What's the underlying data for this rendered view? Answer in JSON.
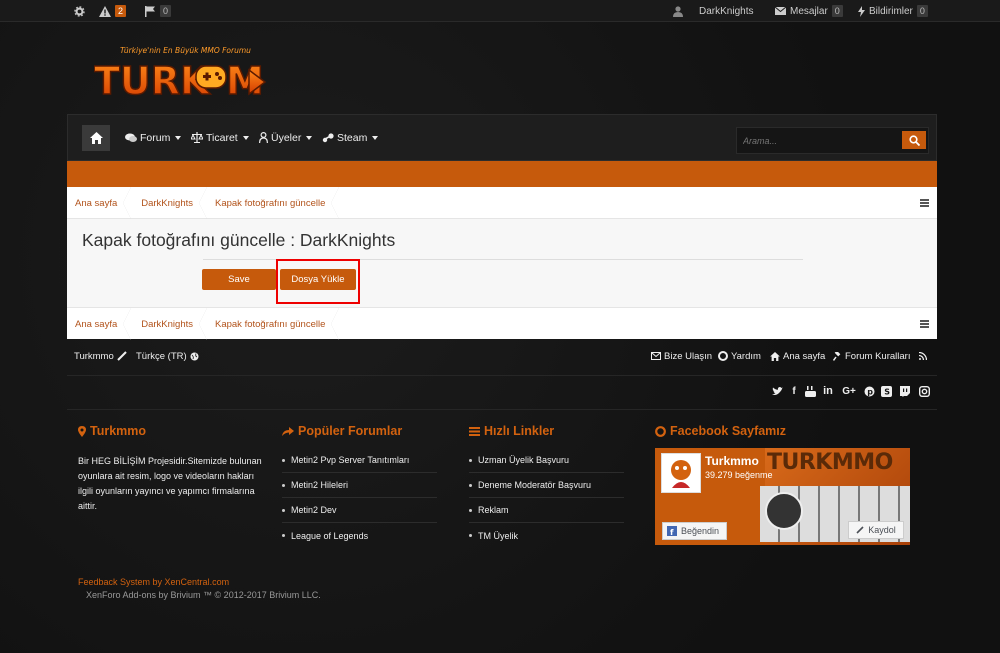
{
  "topbar": {
    "alerts_count": "2",
    "flags_count": "0",
    "username": "DarkKnights",
    "messages_label": "Mesajlar",
    "messages_count": "0",
    "notifications_label": "Bildirimler",
    "notifications_count": "0"
  },
  "logo": {
    "tagline": "Türkiye'nin En Büyük MMO Forumu",
    "name_part1": "TURK",
    "name_part2": "M",
    "name_part3": "O"
  },
  "nav": {
    "items": [
      {
        "label": "Forum"
      },
      {
        "label": "Ticaret"
      },
      {
        "label": "Üyeler"
      },
      {
        "label": "Steam"
      }
    ],
    "search_placeholder": "Arama..."
  },
  "breadcrumb": [
    "Ana sayfa",
    "DarkKnights",
    "Kapak fotoğrafını güncelle"
  ],
  "main": {
    "title": "Kapak fotoğrafını güncelle : DarkKnights",
    "save_label": "Save",
    "upload_label": "Dosya Yükle"
  },
  "footer": {
    "site_name": "Turkmmo",
    "language": "Türkçe (TR)",
    "links": [
      "Bize Ulaşın",
      "Yardım",
      "Ana sayfa",
      "Forum Kuralları"
    ],
    "col1_title": "Turkmmo",
    "col1_text": "Bir HEG BİLİŞİM Projesidir.Sitemizde bulunan oyunlara ait resim, logo ve videoların hakları ilgili oyunların yayıncı ve yapımcı firmalarına aittir.",
    "col2_title": "Popüler Forumlar",
    "col2_items": [
      "Metin2 Pvp Server Tanıtımları",
      "Metin2 Hileleri",
      "Metin2 Dev",
      "League of Legends"
    ],
    "col3_title": "Hızlı Linkler",
    "col3_items": [
      "Uzman Üyelik Başvuru",
      "Deneme Moderatör Başvuru",
      "Reklam",
      "TM Üyelik"
    ],
    "col4_title": "Facebook Sayfamız",
    "fb_name": "Turkmmo",
    "fb_likes": "39.279 beğenme",
    "fb_banner": "TURKMMO",
    "fb_like_btn": "Beğendin",
    "fb_save_btn": "Kaydol",
    "credit1": "Feedback System by XenCentral.com",
    "credit2": "XenForo Add-ons by Brivium ™ © 2012-2017 Brivium LLC."
  },
  "colors": {
    "accent": "#c65a0c",
    "link": "#b2531b",
    "highlight": "#ee0000"
  }
}
